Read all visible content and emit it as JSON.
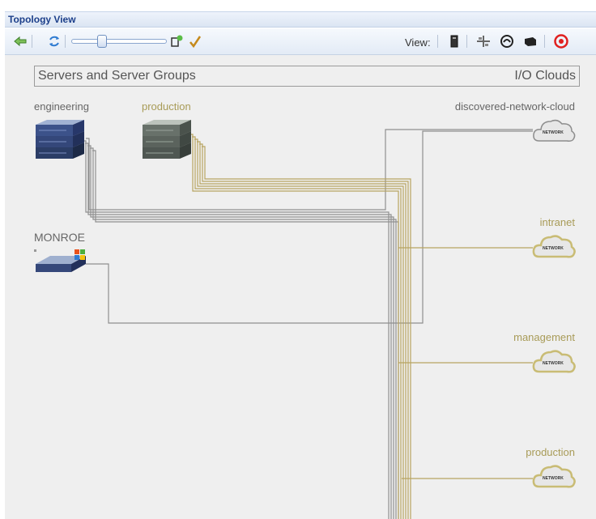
{
  "window": {
    "title": "Topology View"
  },
  "toolbar": {
    "view_label": "View:",
    "zoom_level": 0.3,
    "icons": [
      "back-arrow-icon",
      "refresh-icon",
      "zoom-slider",
      "add-node-icon",
      "check-icon",
      "server-view-icon",
      "network-view-icon",
      "cloud-view-icon",
      "storage-view-icon",
      "stop-icon"
    ]
  },
  "header": {
    "left": "Servers and Server Groups",
    "right": "I/O Clouds"
  },
  "servers": [
    {
      "label": "engineering",
      "style": "grey"
    },
    {
      "label": "production",
      "style": "gold"
    },
    {
      "label": "MONROE",
      "style": "grey"
    }
  ],
  "clouds": [
    {
      "label": "discovered-network-cloud",
      "style": "grey",
      "badge": "NETWORK"
    },
    {
      "label": "intranet",
      "style": "gold",
      "badge": "NETWORK"
    },
    {
      "label": "management",
      "style": "gold",
      "badge": "NETWORK"
    },
    {
      "label": "production",
      "style": "gold",
      "badge": "NETWORK"
    }
  ],
  "colors": {
    "grey_wire": "#8f8f8f",
    "gold_wire": "#b8a460",
    "header_text": "#1c3f8a",
    "stop": "#e0201f"
  }
}
